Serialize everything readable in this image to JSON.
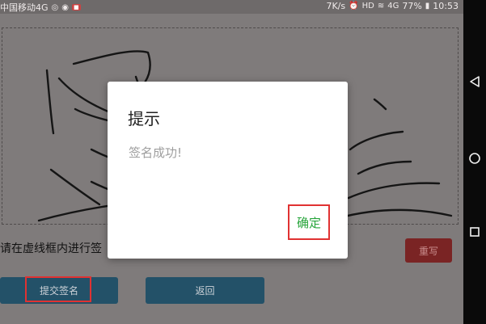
{
  "status_bar": {
    "carrier": "中国移动4G",
    "speed": "7K/s",
    "hd_label": "HD",
    "signal_label": "4G",
    "battery": "77%",
    "time": "10:53"
  },
  "signature_pad": {
    "instruction": "请在虚线框内进行签"
  },
  "buttons": {
    "rewrite": "重写",
    "submit": "提交签名",
    "back": "返回"
  },
  "dialog": {
    "title": "提示",
    "message": "签名成功!",
    "confirm": "确定"
  },
  "colors": {
    "accent_green": "#26a43a",
    "highlight_red": "#e03232",
    "button_blue": "#235168",
    "rewrite_red": "#7a2424"
  },
  "icons": [
    "wechat-icon",
    "camera-icon",
    "alarm-icon",
    "wifi-icon",
    "signal-icon",
    "battery-icon",
    "back-triangle-icon",
    "home-circle-icon",
    "recent-square-icon"
  ]
}
